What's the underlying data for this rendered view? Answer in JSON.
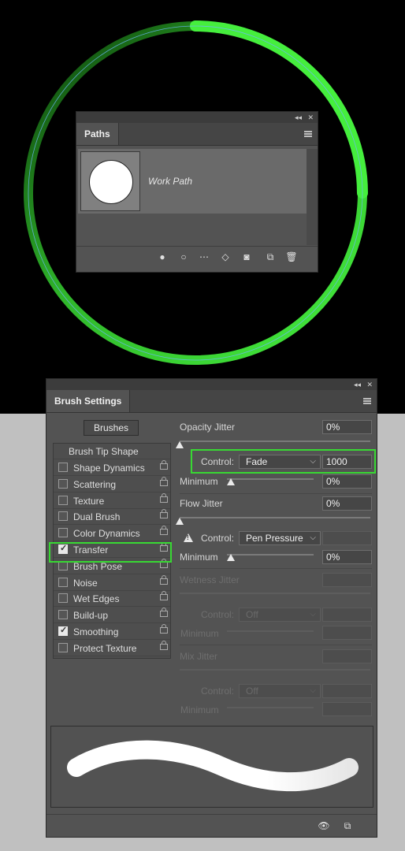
{
  "colors": {
    "ring_green": "#41e83a",
    "highlight": "#38d833",
    "panel": "#535353"
  },
  "paths_panel": {
    "tab": "Paths",
    "collapse_icon": "collapse-arrows-icon",
    "close_icon": "close-icon",
    "menu_icon": "menu-icon",
    "path_item": {
      "name": "Work Path",
      "thumbnail_icon": "circle-path-thumbnail"
    },
    "footer_icons": [
      "fill-path-icon",
      "stroke-path-icon",
      "selection-to-path-icon",
      "path-to-selection-icon",
      "add-mask-icon",
      "new-path-icon",
      "delete-icon"
    ]
  },
  "brush_settings": {
    "tab": "Brush Settings",
    "brushes_button": "Brushes",
    "brush_tip_shape": "Brush Tip Shape",
    "options": [
      {
        "label": "Shape Dynamics",
        "checked": false
      },
      {
        "label": "Scattering",
        "checked": false
      },
      {
        "label": "Texture",
        "checked": false
      },
      {
        "label": "Dual Brush",
        "checked": false
      },
      {
        "label": "Color Dynamics",
        "checked": false
      },
      {
        "label": "Transfer",
        "checked": true,
        "selected": true
      },
      {
        "label": "Brush Pose",
        "checked": false
      },
      {
        "label": "Noise",
        "checked": false
      },
      {
        "label": "Wet Edges",
        "checked": false
      },
      {
        "label": "Build-up",
        "checked": false
      },
      {
        "label": "Smoothing",
        "checked": true
      },
      {
        "label": "Protect Texture",
        "checked": false
      }
    ],
    "opacity_jitter": {
      "label": "Opacity Jitter",
      "value": "0%"
    },
    "opacity_control": {
      "label": "Control:",
      "option": "Fade",
      "value": "1000"
    },
    "opacity_minimum": {
      "label": "Minimum",
      "value": "0%"
    },
    "flow_jitter": {
      "label": "Flow Jitter",
      "value": "0%"
    },
    "flow_control": {
      "label": "Control:",
      "option": "Pen Pressure",
      "value": ""
    },
    "flow_minimum": {
      "label": "Minimum",
      "value": "0%"
    },
    "wetness_jitter": {
      "label": "Wetness Jitter",
      "value": ""
    },
    "wetness_control": {
      "label": "Control:",
      "option": "Off",
      "value": ""
    },
    "wetness_minimum": {
      "label": "Minimum",
      "value": ""
    },
    "mix_jitter": {
      "label": "Mix Jitter",
      "value": ""
    },
    "mix_control": {
      "label": "Control:",
      "option": "Off",
      "value": ""
    },
    "mix_minimum": {
      "label": "Minimum",
      "value": ""
    },
    "footer_icons": [
      "toggle-preview-icon",
      "new-preset-icon"
    ]
  }
}
